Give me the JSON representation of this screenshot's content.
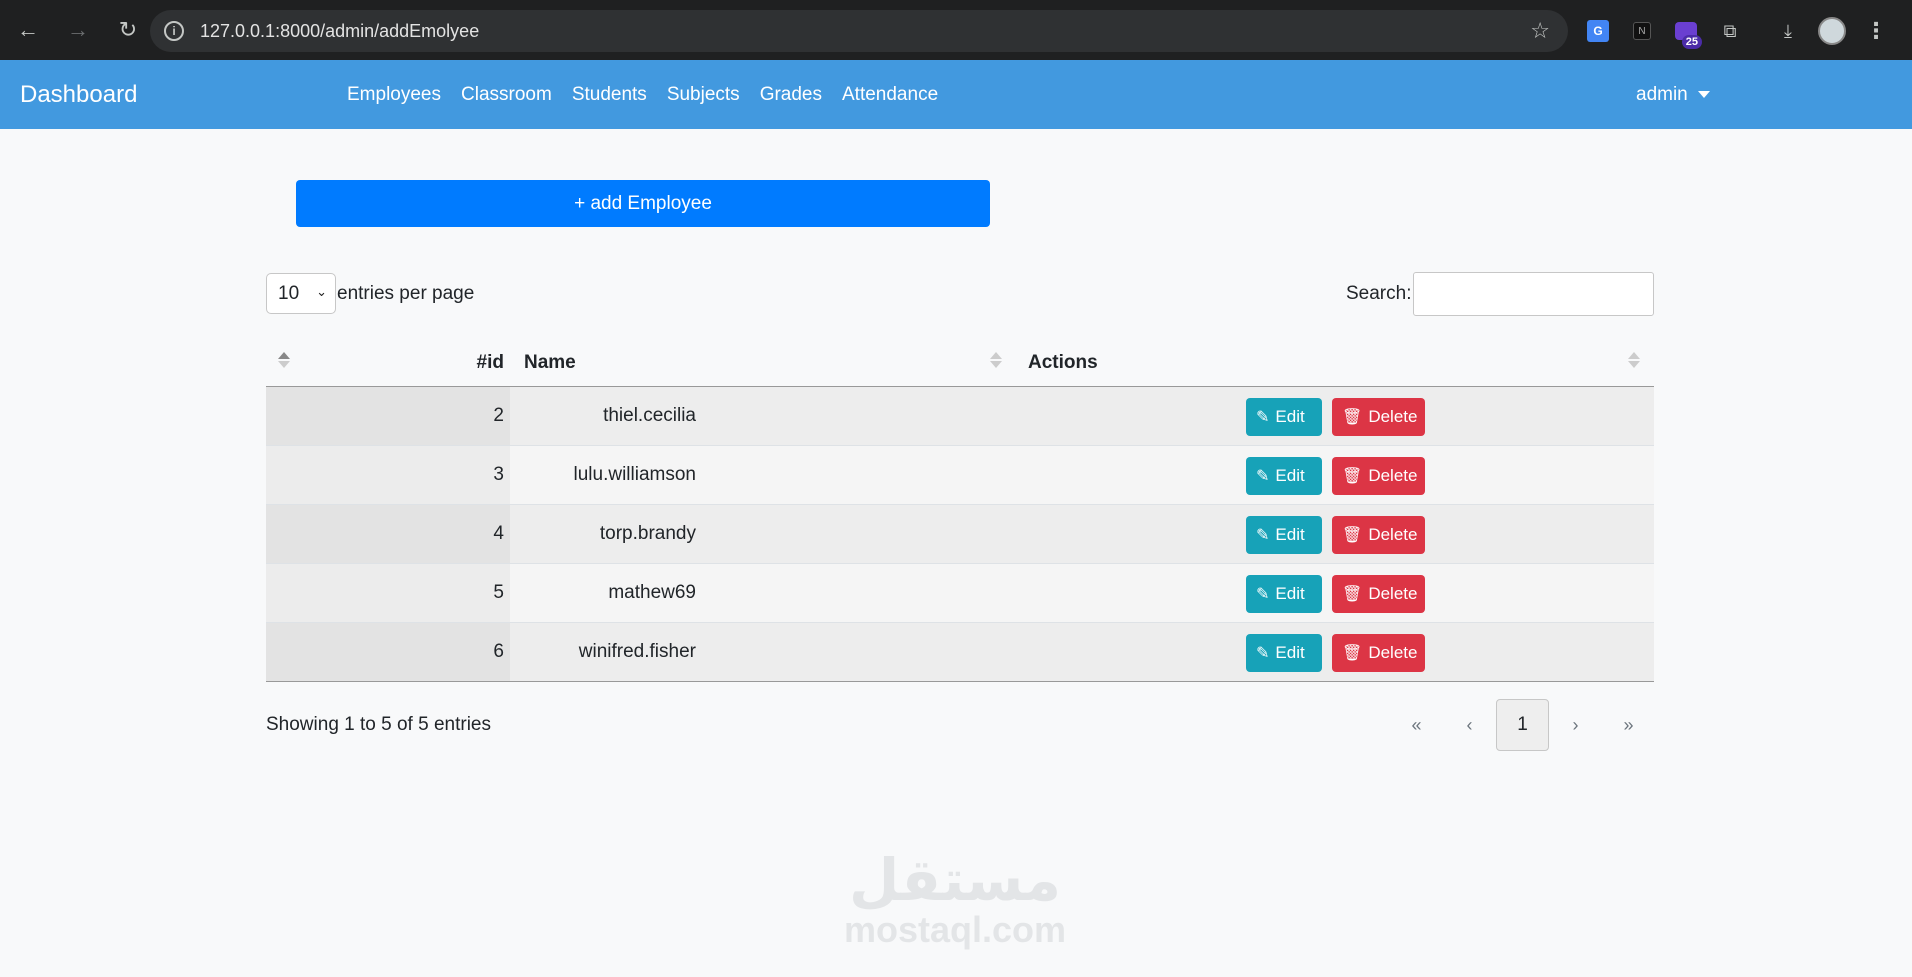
{
  "browser": {
    "url": "127.0.0.1:8000/admin/addEmolyee",
    "extension_badge": "25"
  },
  "navbar": {
    "brand": "Dashboard",
    "links": [
      "Employees",
      "Classroom",
      "Students",
      "Subjects",
      "Grades",
      "Attendance"
    ],
    "user": "admin"
  },
  "add_button": "+ add Employee",
  "table_controls": {
    "per_page_value": "10",
    "per_page_label": "entries per page",
    "search_label": "Search:",
    "search_value": ""
  },
  "table": {
    "columns": [
      "#id",
      "Name",
      "Actions"
    ],
    "rows": [
      {
        "id": "2",
        "name": "thiel.cecilia"
      },
      {
        "id": "3",
        "name": "lulu.williamson"
      },
      {
        "id": "4",
        "name": "torp.brandy"
      },
      {
        "id": "5",
        "name": "mathew69"
      },
      {
        "id": "6",
        "name": "winifred.fisher"
      }
    ],
    "edit_label": "Edit",
    "delete_label": "Delete"
  },
  "info": "Showing 1 to 5 of 5 entries",
  "pagination": {
    "first": "«",
    "prev": "‹",
    "current": "1",
    "next": "›",
    "last": "»"
  },
  "watermark": {
    "arabic": "مستقل",
    "latin": "mostaql.com"
  }
}
